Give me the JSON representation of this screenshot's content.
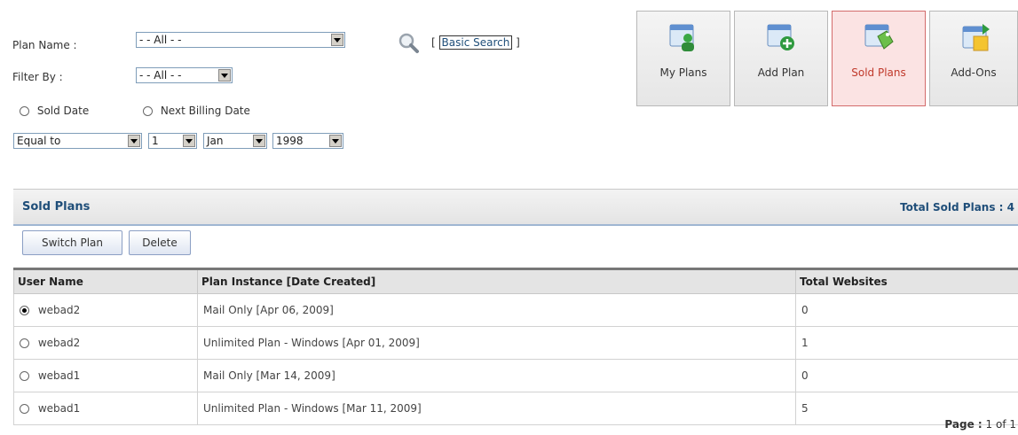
{
  "search": {
    "plan_name_label": "Plan Name :",
    "plan_name_value": "- - All - -",
    "filter_by_label": "Filter By :",
    "filter_by_value": "- - All - -",
    "basic_search_prefix": "[",
    "basic_search_label": "Basic Search",
    "basic_search_suffix": "]",
    "radio_sold_date": "Sold Date",
    "radio_next_billing": "Next Billing Date",
    "condition_value": "Equal to",
    "day_value": "1",
    "month_value": "Jan",
    "year_value": "1998"
  },
  "tiles": [
    {
      "label": "My Plans",
      "icon": "user-card-icon",
      "active": false
    },
    {
      "label": "Add Plan",
      "icon": "add-card-icon",
      "active": false
    },
    {
      "label": "Sold Plans",
      "icon": "tag-card-icon",
      "active": true
    },
    {
      "label": "Add-Ons",
      "icon": "addon-card-icon",
      "active": false
    }
  ],
  "panel": {
    "title": "Sold Plans",
    "total_label": "Total Sold Plans : 4"
  },
  "actions": {
    "switch_plan": "Switch Plan",
    "delete": "Delete"
  },
  "table": {
    "headers": [
      "User Name",
      "Plan Instance [Date Created]",
      "Total Websites"
    ],
    "rows": [
      {
        "user": "webad2",
        "plan": "Mail Only [Apr 06, 2009]",
        "websites": "0",
        "selected": true
      },
      {
        "user": "webad2",
        "plan": "Unlimited Plan - Windows [Apr 01, 2009]",
        "websites": "1",
        "selected": false
      },
      {
        "user": "webad1",
        "plan": "Mail Only [Mar 14, 2009]",
        "websites": "0",
        "selected": false
      },
      {
        "user": "webad1",
        "plan": "Unlimited Plan - Windows [Mar 11, 2009]",
        "websites": "5",
        "selected": false
      }
    ]
  },
  "pagination": {
    "label": "Page :",
    "value": "1 of 1"
  },
  "colors": {
    "accent_border": "#9fb6d2",
    "active_tile": "#d36b6b",
    "bold_text": "#1f4e79"
  }
}
